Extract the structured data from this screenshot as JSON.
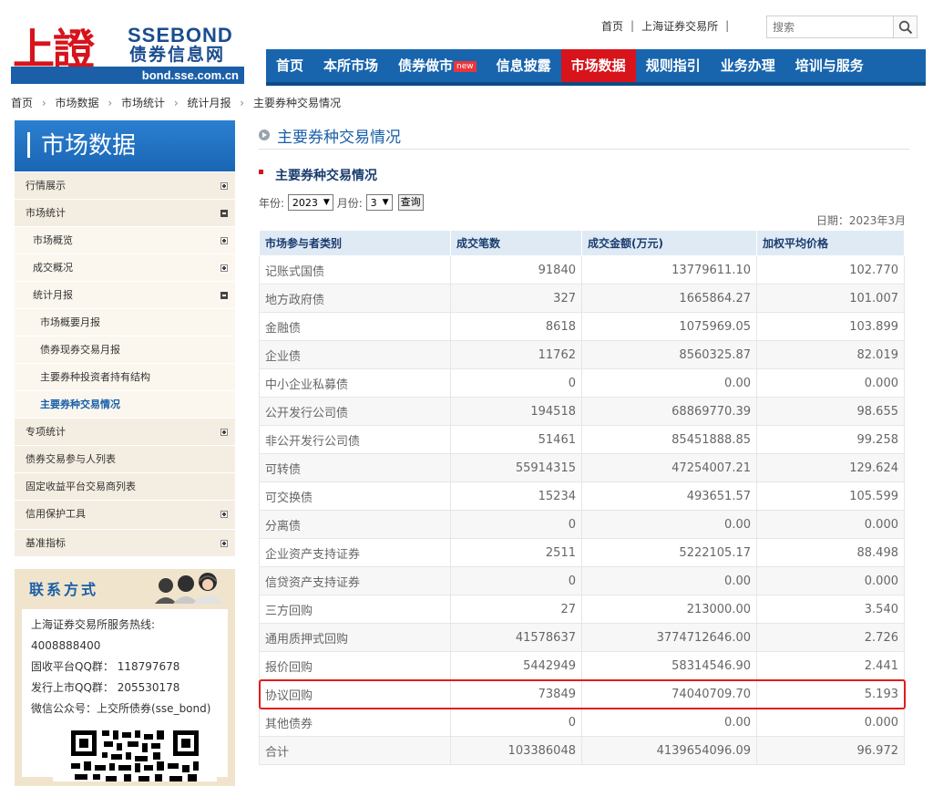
{
  "logo": {
    "cn_big": "上證",
    "en": "SSEBOND",
    "cn": "债券信息网",
    "url": "bond.sse.com.cn"
  },
  "toplinks": {
    "home": "首页",
    "sep": "|",
    "exchange": "上海证券交易所"
  },
  "search": {
    "placeholder": "搜索"
  },
  "nav": {
    "items": [
      {
        "label": "首页"
      },
      {
        "label": "本所市场"
      },
      {
        "label": "债券做市",
        "badge": "new"
      },
      {
        "label": "信息披露"
      },
      {
        "label": "市场数据",
        "active": true
      },
      {
        "label": "规则指引"
      },
      {
        "label": "业务办理"
      },
      {
        "label": "培训与服务"
      }
    ]
  },
  "breadcrumb": [
    "首页",
    "市场数据",
    "市场统计",
    "统计月报",
    "主要券种交易情况"
  ],
  "breadcrumb_arrow": "›",
  "sidebar": {
    "title": "市场数据",
    "menu": [
      {
        "label": "行情展示",
        "level": 1,
        "toggle": "plus"
      },
      {
        "label": "市场统计",
        "level": 1,
        "toggle": "minus"
      },
      {
        "label": "市场概览",
        "level": 2,
        "toggle": "plus"
      },
      {
        "label": "成交概况",
        "level": 2,
        "toggle": "plus"
      },
      {
        "label": "统计月报",
        "level": 2,
        "toggle": "minus"
      },
      {
        "label": "市场概要月报",
        "level": 3
      },
      {
        "label": "债券现券交易月报",
        "level": 3
      },
      {
        "label": "主要券种投资者持有结构",
        "level": 3
      },
      {
        "label": "主要券种交易情况",
        "level": 3,
        "current": true
      },
      {
        "label": "专项统计",
        "level": 2,
        "toggle": "plus"
      },
      {
        "label": "债券交易参与人列表",
        "level": 2
      },
      {
        "label": "固定收益平台交易商列表",
        "level": 2
      },
      {
        "label": "信用保护工具",
        "level": 2,
        "toggle": "plus"
      },
      {
        "label": "基准指标",
        "level": 1,
        "toggle": "plus"
      }
    ]
  },
  "contact": {
    "title": "联系方式",
    "lines": [
      "上海证券交易所服务热线:",
      "4008888400",
      "固收平台QQ群： 118797678",
      "发行上市QQ群： 205530178",
      "微信公众号：上交所债券(sse_bond)"
    ]
  },
  "main": {
    "title": "主要券种交易情况",
    "subtitle": "主要券种交易情况",
    "filter": {
      "year_label": "年份:",
      "year_value": "2023",
      "month_label": "月份:",
      "month_value": "3",
      "query_label": "查询"
    },
    "date_text": "日期：2023年3月"
  },
  "table": {
    "headers": [
      "市场参与者类别",
      "成交笔数",
      "成交金额(万元)",
      "加权平均价格"
    ],
    "rows": [
      [
        "记账式国债",
        "91840",
        "13779611.10",
        "102.770"
      ],
      [
        "地方政府债",
        "327",
        "1665864.27",
        "101.007"
      ],
      [
        "金融债",
        "8618",
        "1075969.05",
        "103.899"
      ],
      [
        "企业债",
        "11762",
        "8560325.87",
        "82.019"
      ],
      [
        "中小企业私募债",
        "0",
        "0.00",
        "0.000"
      ],
      [
        "公开发行公司债",
        "194518",
        "68869770.39",
        "98.655"
      ],
      [
        "非公开发行公司债",
        "51461",
        "85451888.85",
        "99.258"
      ],
      [
        "可转债",
        "55914315",
        "47254007.21",
        "129.624"
      ],
      [
        "可交换债",
        "15234",
        "493651.57",
        "105.599"
      ],
      [
        "分离债",
        "0",
        "0.00",
        "0.000"
      ],
      [
        "企业资产支持证券",
        "2511",
        "5222105.17",
        "88.498"
      ],
      [
        "信贷资产支持证券",
        "0",
        "0.00",
        "0.000"
      ],
      [
        "三方回购",
        "27",
        "213000.00",
        "3.540"
      ],
      [
        "通用质押式回购",
        "41578637",
        "3774712646.00",
        "2.726"
      ],
      [
        "报价回购",
        "5442949",
        "58314546.90",
        "2.441"
      ],
      [
        "协议回购",
        "73849",
        "74040709.70",
        "5.193"
      ],
      [
        "其他债券",
        "0",
        "0.00",
        "0.000"
      ],
      [
        "合计",
        "103386048",
        "4139654096.09",
        "96.972"
      ]
    ],
    "highlighted_row": "协议回购",
    "highlight_color": "#e01d1d"
  },
  "colors": {
    "brand_blue": "#1865ae",
    "brand_red": "#d7131b",
    "header_bg": "#dfeaf5",
    "sidebar_bg": "#f4ede1"
  }
}
